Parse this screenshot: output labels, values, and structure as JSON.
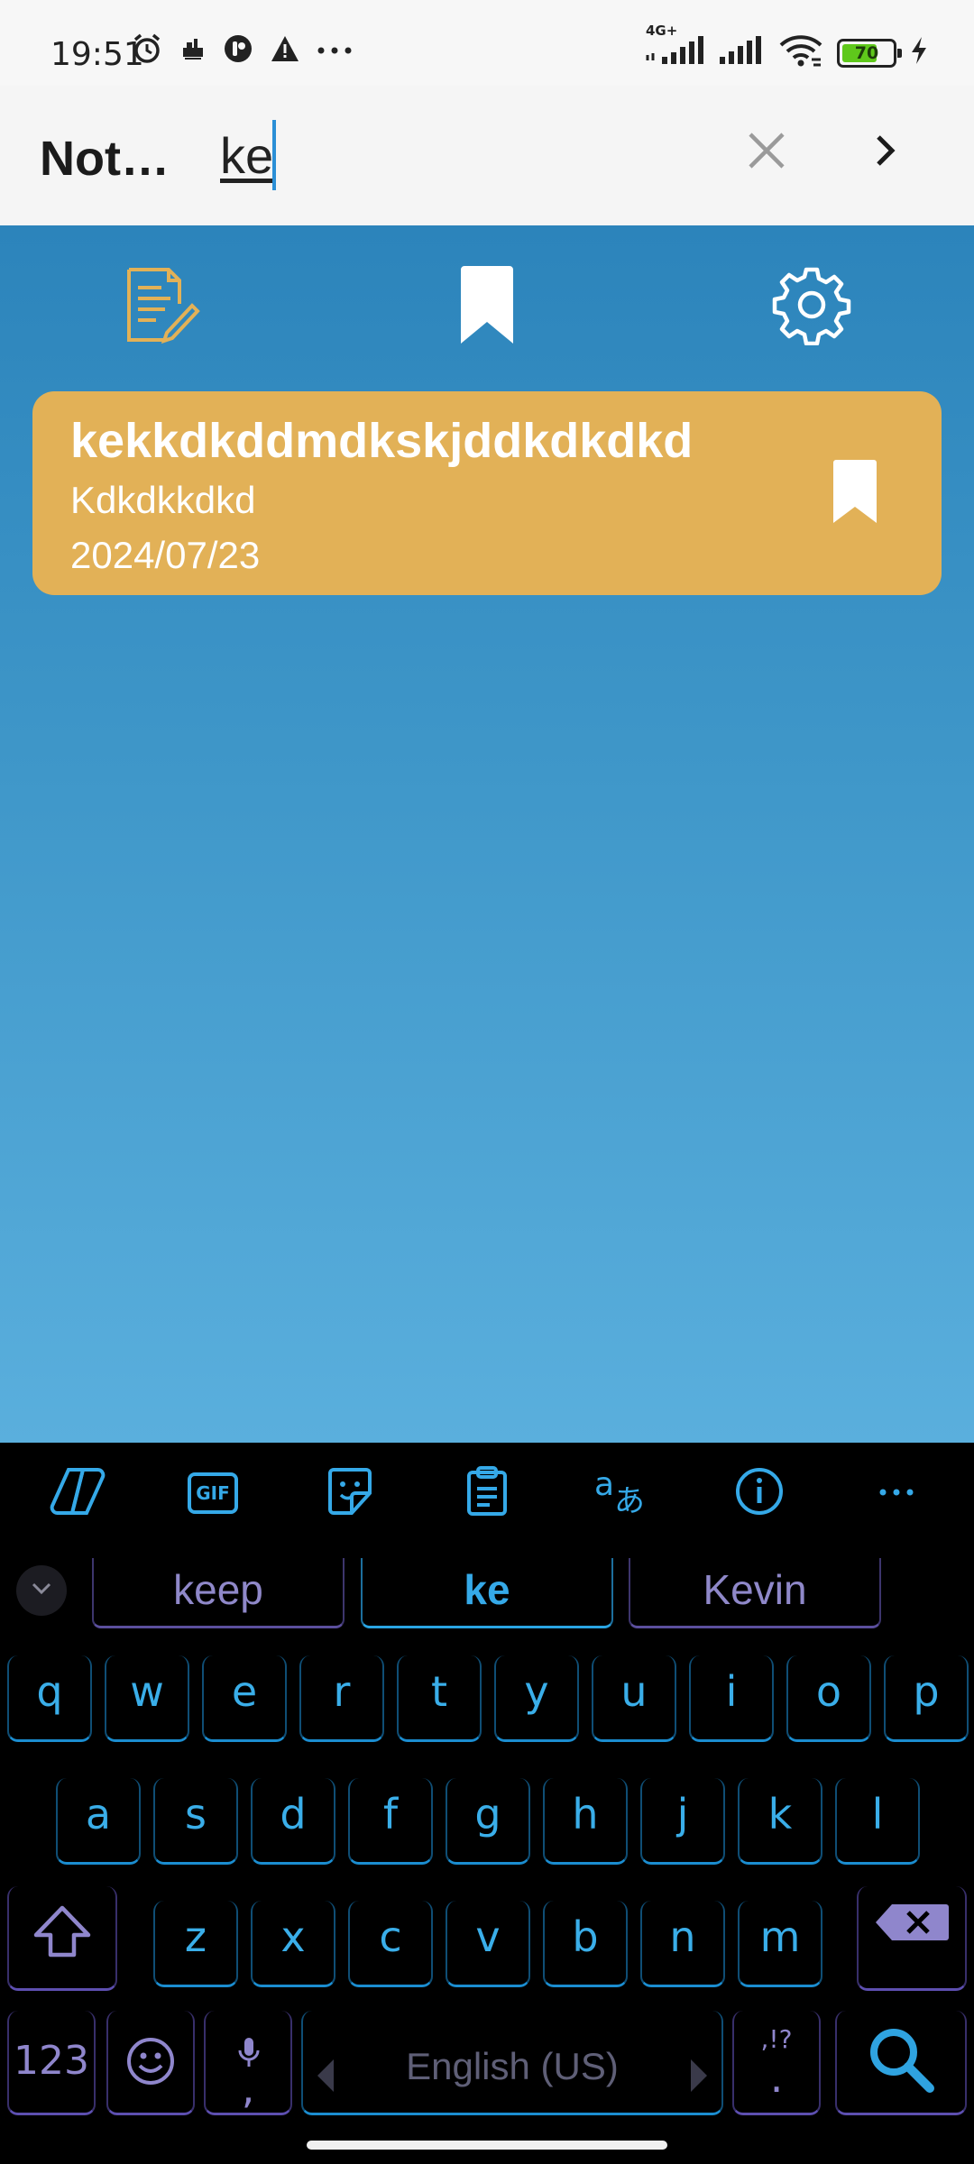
{
  "status_bar": {
    "time": "19:51",
    "network": "4G+",
    "battery_level": "70",
    "battery_fraction": 0.7,
    "icons_left": [
      "alarm-icon",
      "cloud-sync-icon",
      "app-icon",
      "warning-icon",
      "more-dots-icon"
    ],
    "icons_right": [
      "signal-icon",
      "signal-icon",
      "wifi-icon",
      "battery-icon",
      "charging-icon"
    ]
  },
  "header": {
    "title": "Not…",
    "search_value": "ke",
    "clear_icon": "close-icon",
    "next_icon": "chevron-right-icon"
  },
  "tabs": [
    {
      "name": "notes",
      "icon": "note-edit-icon"
    },
    {
      "name": "bookmarks",
      "icon": "bookmark-icon"
    },
    {
      "name": "settings",
      "icon": "gear-icon"
    }
  ],
  "note": {
    "title": "kekkdkddmdkskjddkdkdkd",
    "body": "Kdkdkkdkd",
    "date": "2024/07/23",
    "bookmark_icon": "bookmark-icon"
  },
  "keyboard": {
    "toolbar": [
      "copilot-icon",
      "gif-icon",
      "sticker-icon",
      "clipboard-icon",
      "translate-icon",
      "info-icon",
      "more-icon"
    ],
    "gif_label": "GIF",
    "suggestions": [
      "keep",
      "ke",
      "Kevin"
    ],
    "rows": [
      [
        "q",
        "w",
        "e",
        "r",
        "t",
        "y",
        "u",
        "i",
        "o",
        "p"
      ],
      [
        "a",
        "s",
        "d",
        "f",
        "g",
        "h",
        "j",
        "k",
        "l"
      ],
      [
        "z",
        "x",
        "c",
        "v",
        "b",
        "n",
        "m"
      ]
    ],
    "numbers_label": "123",
    "comma_label": ",",
    "period_label": ".",
    "punct_hint": ",!?",
    "space_label": "English (US)"
  },
  "colors": {
    "accent": "#2b8fd6",
    "card": "#e2b157",
    "key_blue": "#3aaee9",
    "key_purple": "#8f86cc"
  }
}
